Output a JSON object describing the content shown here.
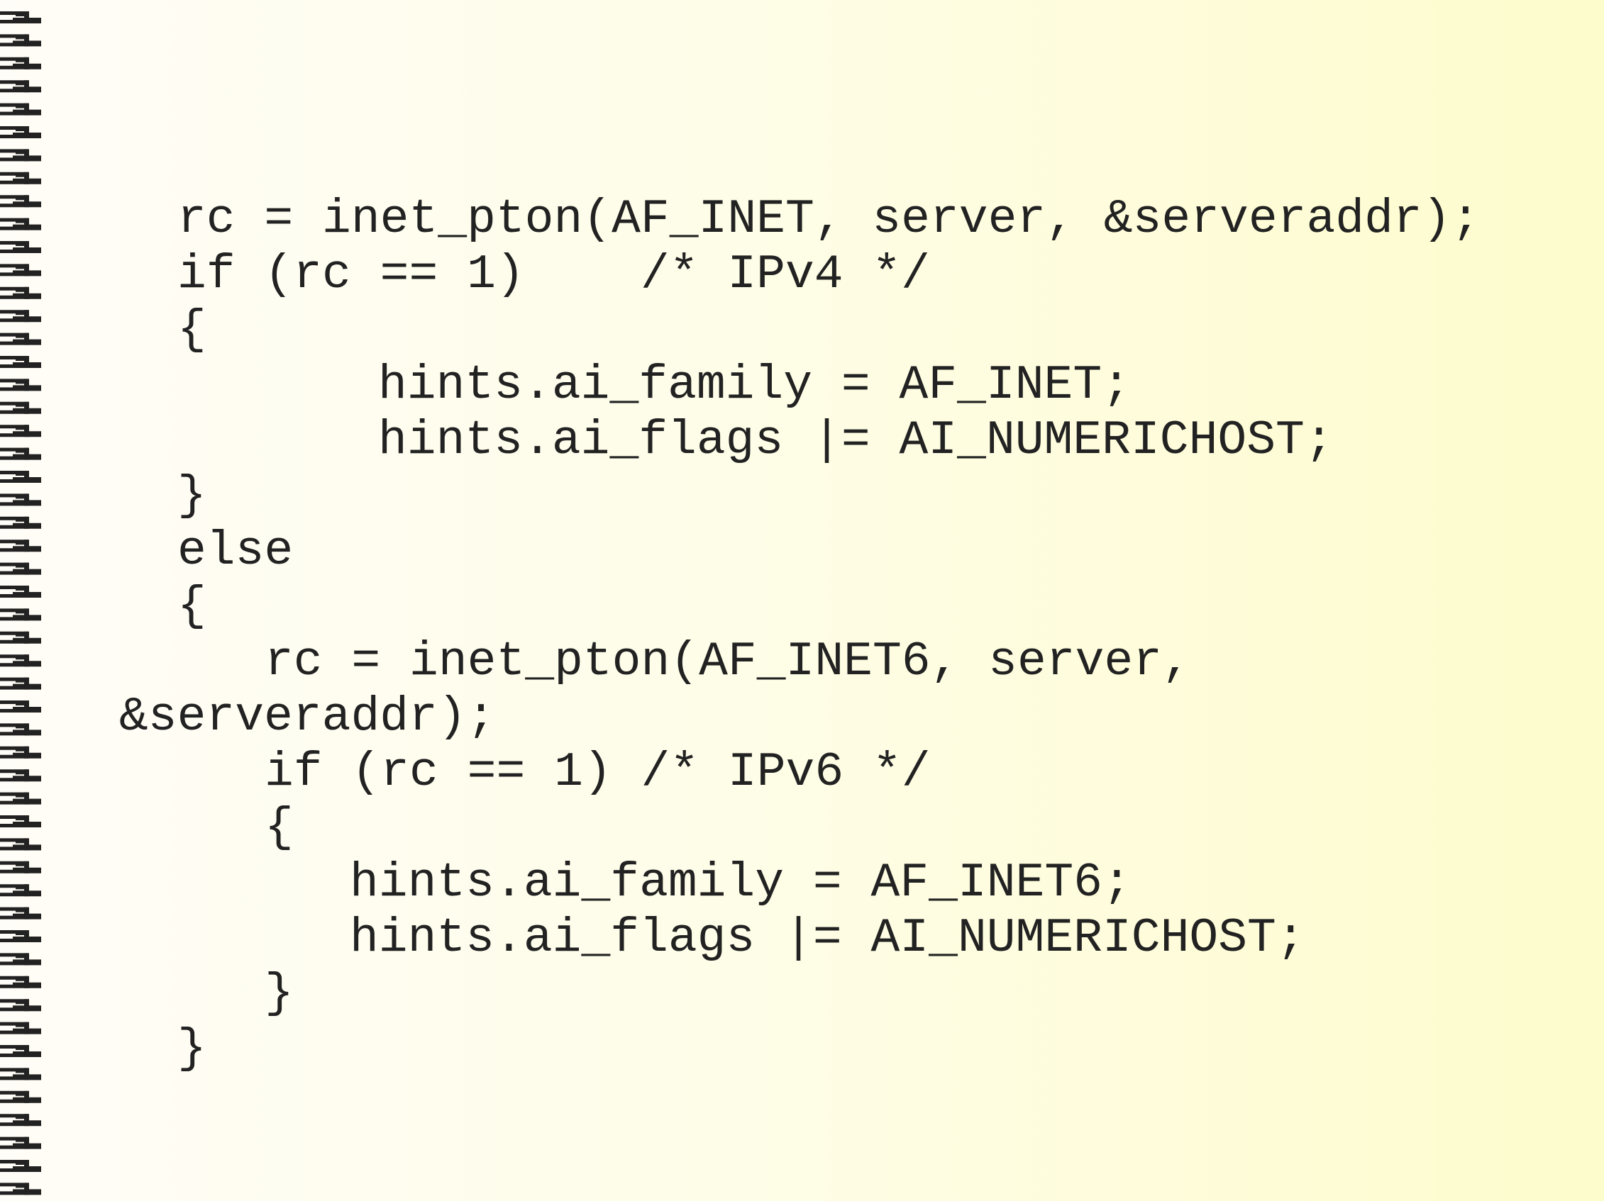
{
  "code_lines": [
    "rc = inet_pton(AF_INET, server, &serveraddr);",
    "if (rc == 1)    /* IPv4 */",
    "{",
    "hints.ai_family = AF_INET;",
    "hints.ai_flags |= AI_NUMERICHOST;",
    "}",
    "else",
    "{",
    "rc = inet_pton(AF_INET6, server,",
    "&serveraddr);",
    "if (rc == 1) /* IPv6 */",
    "{",
    "hints.ai_family = AF_INET6;",
    "hints.ai_flags |= AI_NUMERICHOST;",
    "}",
    "}"
  ],
  "colors": {
    "text": "#222222",
    "spiral": "#222222",
    "background_left": "#fffdf7",
    "background_right": "#fdfccc"
  },
  "icons": {
    "binding": "spiral-binding-icon"
  }
}
